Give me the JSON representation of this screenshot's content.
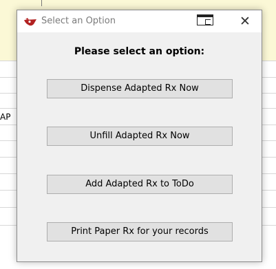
{
  "background": {
    "partial_label": "AP"
  },
  "dialog": {
    "title": "Select an Option",
    "heading": "Please select an option:",
    "close_glyph": "✕",
    "options": [
      {
        "label": "Dispense Adapted Rx Now"
      },
      {
        "label": "Unfill Adapted Rx Now"
      },
      {
        "label": "Add Adapted Rx to ToDo"
      },
      {
        "label": "Print Paper Rx for your records"
      }
    ]
  },
  "colors": {
    "dialog_bg": "#f0f0f0",
    "button_bg": "#e1e1e1",
    "button_border": "#adadad",
    "background_highlight": "#fbf8d6",
    "app_icon": "#b22222"
  },
  "icons": {
    "title_icon": "app-logo-icon",
    "restore": "restore-window-icon",
    "close": "close-icon"
  }
}
